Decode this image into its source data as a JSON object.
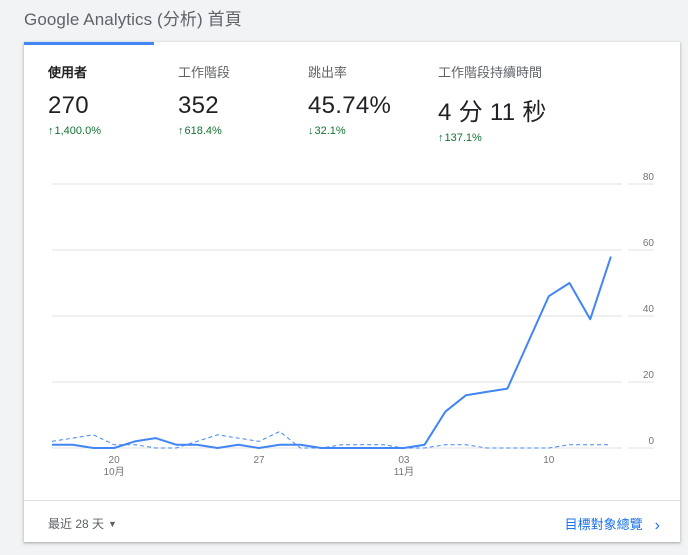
{
  "header": {
    "title": "Google Analytics (分析) 首頁"
  },
  "metrics": [
    {
      "label": "使用者",
      "value": "270",
      "change": "1,400.0%",
      "direction": "up"
    },
    {
      "label": "工作階段",
      "value": "352",
      "change": "618.4%",
      "direction": "up"
    },
    {
      "label": "跳出率",
      "value": "45.74%",
      "change": "32.1%",
      "direction": "down"
    },
    {
      "label": "工作階段持續時間",
      "value": "4 分 11 秒",
      "change": "137.1%",
      "direction": "up"
    }
  ],
  "footer": {
    "range_label": "最近 28 天",
    "link_label": "目標對象總覽"
  },
  "colors": {
    "accent": "#4285f4",
    "positive": "#137333",
    "link": "#1a73e8"
  },
  "chart_data": {
    "type": "line",
    "ylim": [
      0,
      80
    ],
    "yticks": [
      "0",
      "20",
      "40",
      "60",
      "80"
    ],
    "xticks": [
      {
        "label": "20",
        "sublabel": "10月",
        "index": 3
      },
      {
        "label": "27",
        "sublabel": "",
        "index": 10
      },
      {
        "label": "03",
        "sublabel": "11月",
        "index": 17
      },
      {
        "label": "10",
        "sublabel": "",
        "index": 24
      }
    ],
    "series": [
      {
        "style": "solid",
        "values": [
          1,
          1,
          0,
          0,
          2,
          3,
          1,
          1,
          0,
          1,
          0,
          1,
          1,
          0,
          0,
          0,
          0,
          0,
          1,
          11,
          16,
          17,
          18,
          32,
          46,
          50,
          39,
          58
        ]
      },
      {
        "style": "dashed",
        "values": [
          2,
          3,
          4,
          1,
          1,
          0,
          0,
          2,
          4,
          3,
          2,
          5,
          0,
          0,
          1,
          1,
          1,
          0,
          0,
          1,
          1,
          0,
          0,
          0,
          0,
          1,
          1,
          1
        ]
      }
    ]
  }
}
